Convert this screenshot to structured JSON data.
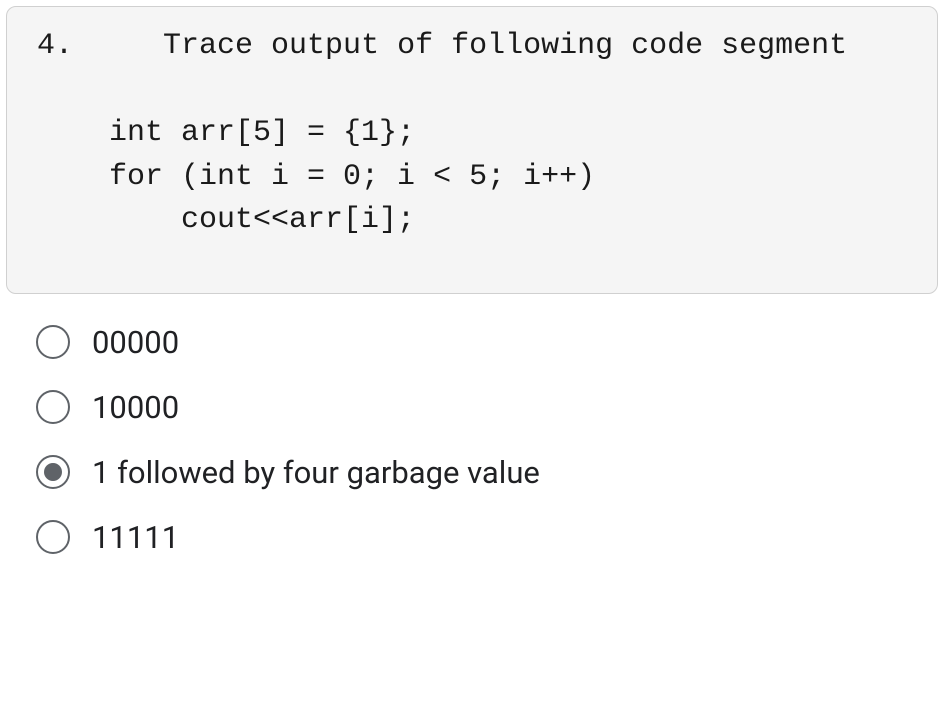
{
  "code_block": {
    "number": "4.",
    "prompt": "Trace output of following code segment",
    "code_lines": [
      "    int arr[5] = {1};",
      "    for (int i = 0; i < 5; i++)",
      "        cout<<arr[i];"
    ]
  },
  "options": [
    {
      "label": "00000",
      "selected": false
    },
    {
      "label": "10000",
      "selected": false
    },
    {
      "label": "1 followed by four garbage value",
      "selected": true
    },
    {
      "label": "11111",
      "selected": false
    }
  ]
}
